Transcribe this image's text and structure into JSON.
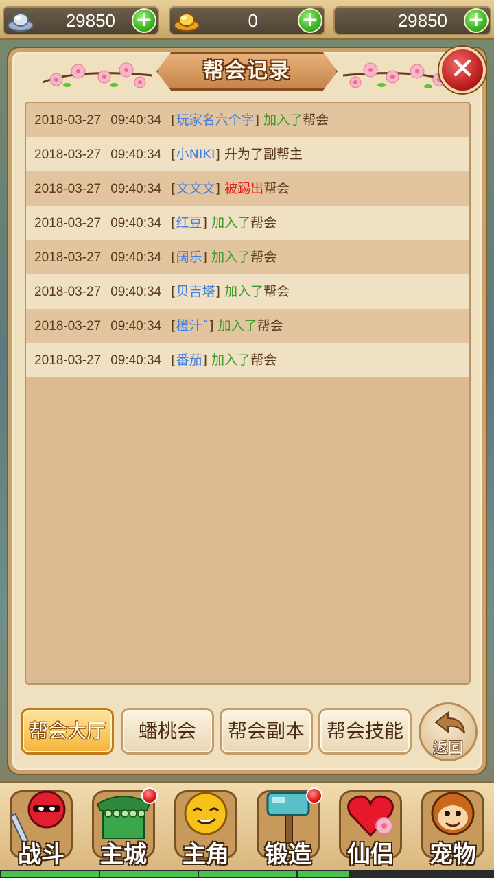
{
  "currencies": [
    {
      "icon": "silver-ingot-icon",
      "value": "29850"
    },
    {
      "icon": "gold-ingot-icon",
      "value": "0"
    },
    {
      "icon": "",
      "value": "29850"
    }
  ],
  "plus_label": "+",
  "panel": {
    "title": "帮会记录",
    "close_label": "✕"
  },
  "records": [
    {
      "date": "2018-03-27",
      "time": "09:40:34",
      "name": "玩家名六个字",
      "action": "加入了",
      "action_type": "join",
      "tail": "帮会"
    },
    {
      "date": "2018-03-27",
      "time": "09:40:34",
      "name": "小NIKI",
      "action": "升为了副帮主",
      "action_type": "promote",
      "tail": ""
    },
    {
      "date": "2018-03-27",
      "time": "09:40:34",
      "name": "文文文",
      "action": "被踢出",
      "action_type": "kick",
      "tail": "帮会"
    },
    {
      "date": "2018-03-27",
      "time": "09:40:34",
      "name": "红豆",
      "action": "加入了",
      "action_type": "join",
      "tail": "帮会"
    },
    {
      "date": "2018-03-27",
      "time": "09:40:34",
      "name": "阔乐",
      "action": "加入了",
      "action_type": "join",
      "tail": "帮会"
    },
    {
      "date": "2018-03-27",
      "time": "09:40:34",
      "name": "贝吉塔",
      "action": "加入了",
      "action_type": "join",
      "tail": "帮会"
    },
    {
      "date": "2018-03-27",
      "time": "09:40:34",
      "name": "橙汁ˇ",
      "action": "加入了",
      "action_type": "join",
      "tail": "帮会"
    },
    {
      "date": "2018-03-27",
      "time": "09:40:34",
      "name": "番茄",
      "action": "加入了",
      "action_type": "join",
      "tail": "帮会"
    }
  ],
  "tabs": [
    {
      "label": "帮会大厅",
      "active": true
    },
    {
      "label": "蟠桃会",
      "active": false
    },
    {
      "label": "帮会副本",
      "active": false
    },
    {
      "label": "帮会技能",
      "active": false
    }
  ],
  "back_label": "返回",
  "nav": [
    {
      "label": "战斗",
      "icon": "ninja-sword-icon",
      "badge": false
    },
    {
      "label": "主城",
      "icon": "city-gate-icon",
      "badge": true
    },
    {
      "label": "主角",
      "icon": "hero-face-icon",
      "badge": false
    },
    {
      "label": "锻造",
      "icon": "hammer-icon",
      "badge": true
    },
    {
      "label": "仙侣",
      "icon": "heart-flower-icon",
      "badge": false
    },
    {
      "label": "宠物",
      "icon": "monkey-face-icon",
      "badge": false
    }
  ],
  "colors": {
    "name": "#3f7fe0",
    "join": "#3a9a2a",
    "kick": "#e61c1c",
    "text": "#5a3a1c"
  }
}
